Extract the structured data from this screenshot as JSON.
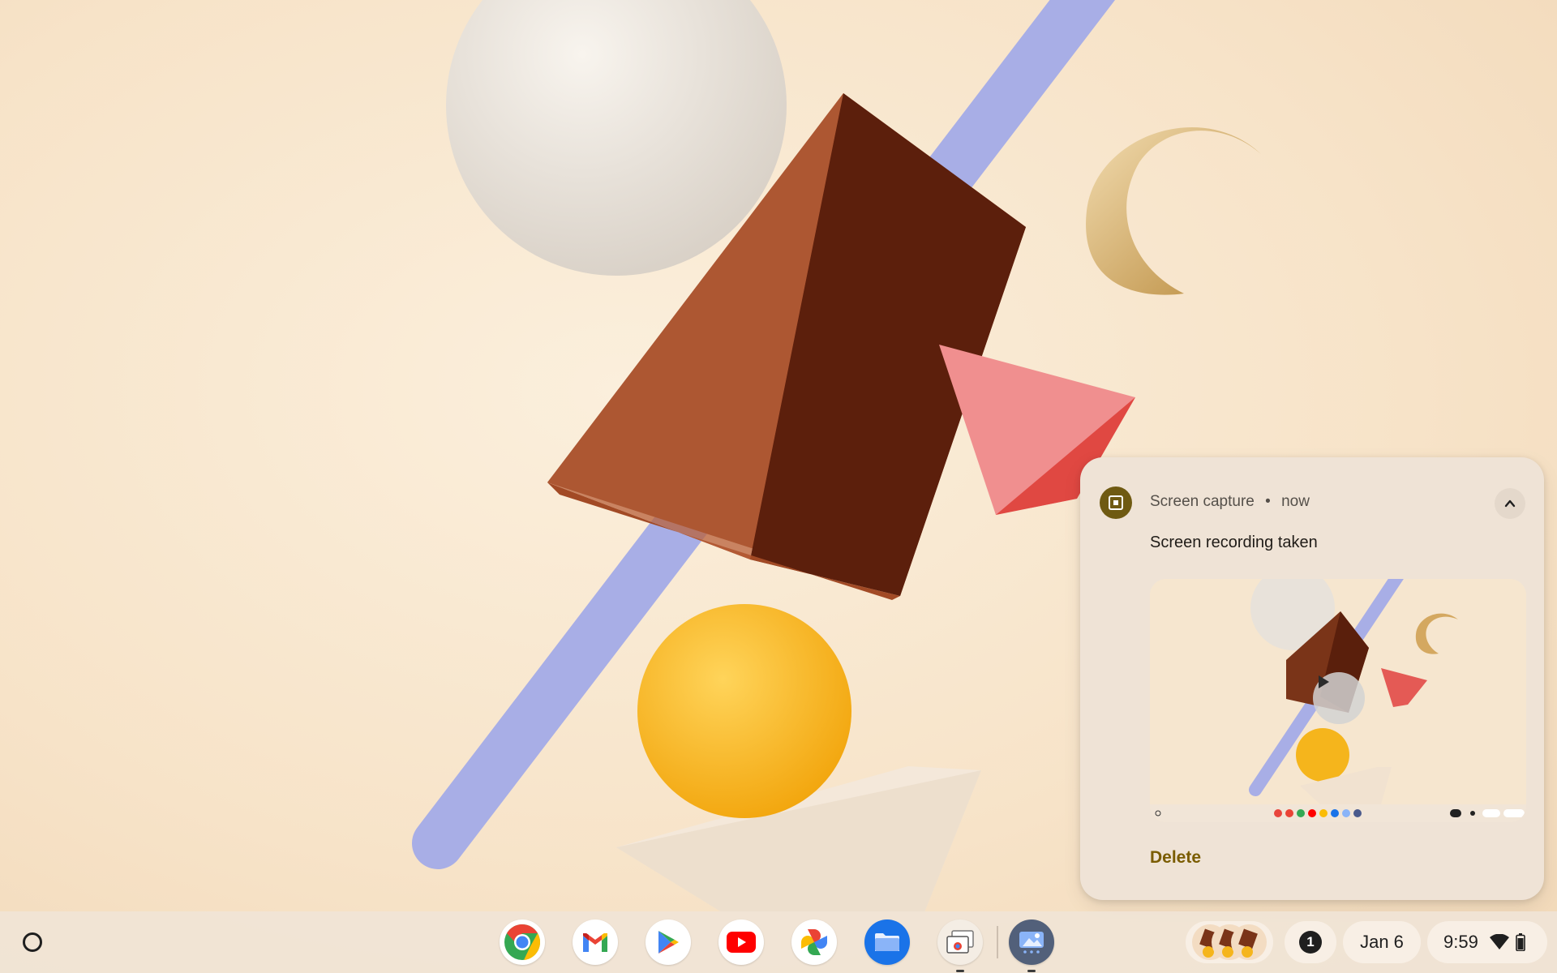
{
  "notification": {
    "app_name": "Screen capture",
    "separator": "•",
    "time": "now",
    "title": "Screen recording taken",
    "delete_label": "Delete",
    "icon": "screen-capture-icon",
    "expand_icon": "chevron-up-icon",
    "play_icon": "play-icon"
  },
  "shelf": {
    "launcher_icon": "launcher-icon",
    "apps": [
      {
        "name": "Chrome",
        "icon": "chrome-icon"
      },
      {
        "name": "Gmail",
        "icon": "gmail-icon"
      },
      {
        "name": "Play Store",
        "icon": "play-store-icon"
      },
      {
        "name": "YouTube",
        "icon": "youtube-icon"
      },
      {
        "name": "Photos",
        "icon": "photos-icon"
      },
      {
        "name": "Files",
        "icon": "files-icon"
      },
      {
        "name": "Screen capture window",
        "icon": "screen-capture-window-icon"
      },
      {
        "name": "Gallery",
        "icon": "gallery-icon"
      }
    ],
    "notification_count": "1",
    "date": "Jan 6",
    "time": "9:59",
    "status_icons": [
      "wifi-icon",
      "battery-icon"
    ]
  },
  "colors": {
    "accent": "#7a5c00",
    "notification_bg": "#efe3d6",
    "shelf_bg": "#f0e4d6"
  }
}
